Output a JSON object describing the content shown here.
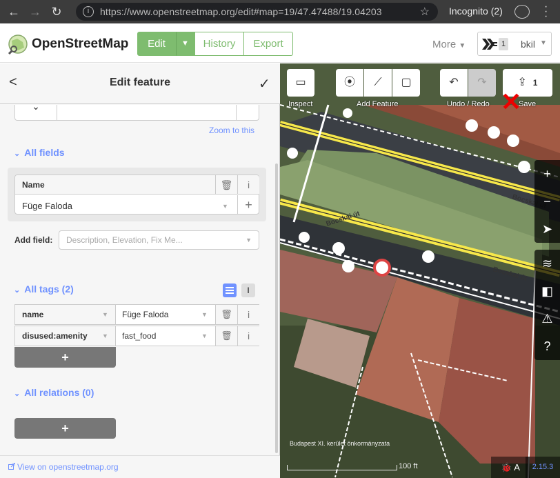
{
  "browser": {
    "url": "https://www.openstreetmap.org/edit#map=19/47.47488/19.04203",
    "incognito_label": "Incognito (2)"
  },
  "osm": {
    "brand": "OpenStreetMap",
    "tabs": {
      "edit": "Edit",
      "history": "History",
      "export": "Export"
    },
    "more": "More",
    "user_count": "1",
    "username": "bkil"
  },
  "sidebar": {
    "title": "Edit feature",
    "zoom_link": "Zoom to this",
    "all_fields": "All fields",
    "field_name_label": "Name",
    "field_name_value": "Füge Faloda",
    "add_field_label": "Add field:",
    "add_field_placeholder": "Description, Elevation, Fix Me...",
    "all_tags": "All tags (2)",
    "tags": [
      {
        "key": "name",
        "value": "Füge Faloda"
      },
      {
        "key": "disused:amenity",
        "value": "fast_food"
      }
    ],
    "all_relations": "All relations (0)",
    "view_link": "View on openstreetmap.org"
  },
  "map": {
    "toolbar": {
      "inspect": "Inspect",
      "add_feature": "Add Feature",
      "undo_redo": "Undo / Redo",
      "save": "Save",
      "save_count": "1"
    },
    "street_name": "Bocskai út",
    "attribution": "Budapest XI. kerület önkormányzata",
    "scale_label": "100 ft",
    "version": "2.15.3"
  },
  "colors": {
    "accent_green": "#7ebc6f",
    "link_blue": "#7092ff",
    "road_yellow": "#f7e84a"
  }
}
